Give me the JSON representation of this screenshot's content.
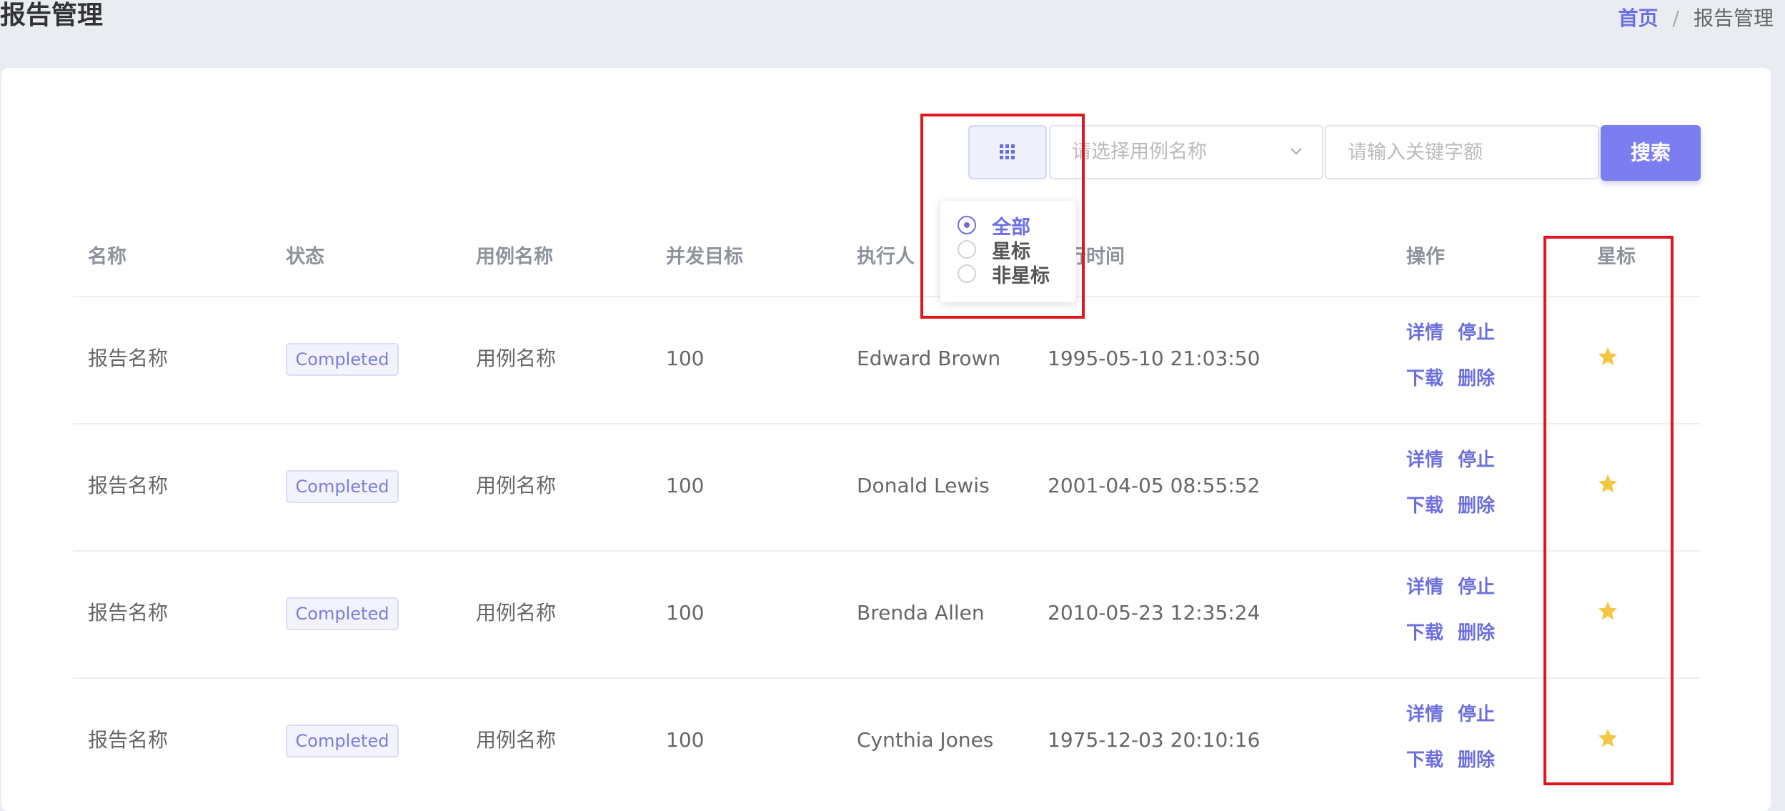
{
  "header": {
    "title": "报告管理",
    "breadcrumb_home": "首页",
    "breadcrumb_sep": "/",
    "breadcrumb_current": "报告管理"
  },
  "toolbar": {
    "case_select_placeholder": "请选择用例名称",
    "keyword_placeholder": "请输入关键字额",
    "search_label": "搜索"
  },
  "filter_popover": {
    "options": [
      {
        "label": "全部",
        "checked": true
      },
      {
        "label": "星标",
        "checked": false
      },
      {
        "label": "非星标",
        "checked": false
      }
    ]
  },
  "table": {
    "headers": [
      "名称",
      "状态",
      "用例名称",
      "并发目标",
      "执行人",
      "执行时间",
      "操作",
      "星标"
    ],
    "actions": {
      "detail": "详情",
      "stop": "停止",
      "download": "下载",
      "delete": "删除"
    },
    "rows": [
      {
        "name": "报告名称",
        "status": "Completed",
        "case": "用例名称",
        "target": "100",
        "executor": "Edward Brown",
        "time": "1995-05-10 21:03:50",
        "starred": true
      },
      {
        "name": "报告名称",
        "status": "Completed",
        "case": "用例名称",
        "target": "100",
        "executor": "Donald Lewis",
        "time": "2001-04-05 08:55:52",
        "starred": true
      },
      {
        "name": "报告名称",
        "status": "Completed",
        "case": "用例名称",
        "target": "100",
        "executor": "Brenda Allen",
        "time": "2010-05-23 12:35:24",
        "starred": true
      },
      {
        "name": "报告名称",
        "status": "Completed",
        "case": "用例名称",
        "target": "100",
        "executor": "Cynthia Jones",
        "time": "1975-12-03 20:10:16",
        "starred": true
      }
    ]
  },
  "colors": {
    "accent": "#6c6fe0",
    "star": "#f5c543",
    "highlight": "#e0161c"
  }
}
